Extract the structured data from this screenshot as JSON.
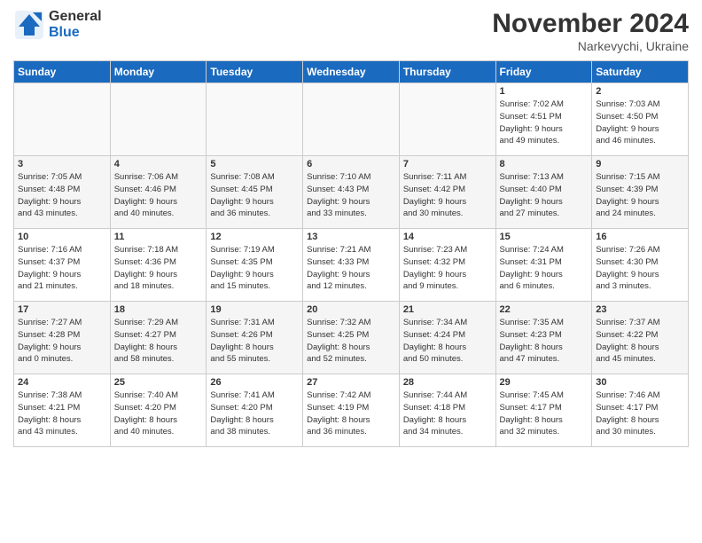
{
  "logo": {
    "general": "General",
    "blue": "Blue"
  },
  "title": "November 2024",
  "location": "Narkevychi, Ukraine",
  "days_of_week": [
    "Sunday",
    "Monday",
    "Tuesday",
    "Wednesday",
    "Thursday",
    "Friday",
    "Saturday"
  ],
  "weeks": [
    [
      {
        "day": "",
        "info": ""
      },
      {
        "day": "",
        "info": ""
      },
      {
        "day": "",
        "info": ""
      },
      {
        "day": "",
        "info": ""
      },
      {
        "day": "",
        "info": ""
      },
      {
        "day": "1",
        "info": "Sunrise: 7:02 AM\nSunset: 4:51 PM\nDaylight: 9 hours\nand 49 minutes."
      },
      {
        "day": "2",
        "info": "Sunrise: 7:03 AM\nSunset: 4:50 PM\nDaylight: 9 hours\nand 46 minutes."
      }
    ],
    [
      {
        "day": "3",
        "info": "Sunrise: 7:05 AM\nSunset: 4:48 PM\nDaylight: 9 hours\nand 43 minutes."
      },
      {
        "day": "4",
        "info": "Sunrise: 7:06 AM\nSunset: 4:46 PM\nDaylight: 9 hours\nand 40 minutes."
      },
      {
        "day": "5",
        "info": "Sunrise: 7:08 AM\nSunset: 4:45 PM\nDaylight: 9 hours\nand 36 minutes."
      },
      {
        "day": "6",
        "info": "Sunrise: 7:10 AM\nSunset: 4:43 PM\nDaylight: 9 hours\nand 33 minutes."
      },
      {
        "day": "7",
        "info": "Sunrise: 7:11 AM\nSunset: 4:42 PM\nDaylight: 9 hours\nand 30 minutes."
      },
      {
        "day": "8",
        "info": "Sunrise: 7:13 AM\nSunset: 4:40 PM\nDaylight: 9 hours\nand 27 minutes."
      },
      {
        "day": "9",
        "info": "Sunrise: 7:15 AM\nSunset: 4:39 PM\nDaylight: 9 hours\nand 24 minutes."
      }
    ],
    [
      {
        "day": "10",
        "info": "Sunrise: 7:16 AM\nSunset: 4:37 PM\nDaylight: 9 hours\nand 21 minutes."
      },
      {
        "day": "11",
        "info": "Sunrise: 7:18 AM\nSunset: 4:36 PM\nDaylight: 9 hours\nand 18 minutes."
      },
      {
        "day": "12",
        "info": "Sunrise: 7:19 AM\nSunset: 4:35 PM\nDaylight: 9 hours\nand 15 minutes."
      },
      {
        "day": "13",
        "info": "Sunrise: 7:21 AM\nSunset: 4:33 PM\nDaylight: 9 hours\nand 12 minutes."
      },
      {
        "day": "14",
        "info": "Sunrise: 7:23 AM\nSunset: 4:32 PM\nDaylight: 9 hours\nand 9 minutes."
      },
      {
        "day": "15",
        "info": "Sunrise: 7:24 AM\nSunset: 4:31 PM\nDaylight: 9 hours\nand 6 minutes."
      },
      {
        "day": "16",
        "info": "Sunrise: 7:26 AM\nSunset: 4:30 PM\nDaylight: 9 hours\nand 3 minutes."
      }
    ],
    [
      {
        "day": "17",
        "info": "Sunrise: 7:27 AM\nSunset: 4:28 PM\nDaylight: 9 hours\nand 0 minutes."
      },
      {
        "day": "18",
        "info": "Sunrise: 7:29 AM\nSunset: 4:27 PM\nDaylight: 8 hours\nand 58 minutes."
      },
      {
        "day": "19",
        "info": "Sunrise: 7:31 AM\nSunset: 4:26 PM\nDaylight: 8 hours\nand 55 minutes."
      },
      {
        "day": "20",
        "info": "Sunrise: 7:32 AM\nSunset: 4:25 PM\nDaylight: 8 hours\nand 52 minutes."
      },
      {
        "day": "21",
        "info": "Sunrise: 7:34 AM\nSunset: 4:24 PM\nDaylight: 8 hours\nand 50 minutes."
      },
      {
        "day": "22",
        "info": "Sunrise: 7:35 AM\nSunset: 4:23 PM\nDaylight: 8 hours\nand 47 minutes."
      },
      {
        "day": "23",
        "info": "Sunrise: 7:37 AM\nSunset: 4:22 PM\nDaylight: 8 hours\nand 45 minutes."
      }
    ],
    [
      {
        "day": "24",
        "info": "Sunrise: 7:38 AM\nSunset: 4:21 PM\nDaylight: 8 hours\nand 43 minutes."
      },
      {
        "day": "25",
        "info": "Sunrise: 7:40 AM\nSunset: 4:20 PM\nDaylight: 8 hours\nand 40 minutes."
      },
      {
        "day": "26",
        "info": "Sunrise: 7:41 AM\nSunset: 4:20 PM\nDaylight: 8 hours\nand 38 minutes."
      },
      {
        "day": "27",
        "info": "Sunrise: 7:42 AM\nSunset: 4:19 PM\nDaylight: 8 hours\nand 36 minutes."
      },
      {
        "day": "28",
        "info": "Sunrise: 7:44 AM\nSunset: 4:18 PM\nDaylight: 8 hours\nand 34 minutes."
      },
      {
        "day": "29",
        "info": "Sunrise: 7:45 AM\nSunset: 4:17 PM\nDaylight: 8 hours\nand 32 minutes."
      },
      {
        "day": "30",
        "info": "Sunrise: 7:46 AM\nSunset: 4:17 PM\nDaylight: 8 hours\nand 30 minutes."
      }
    ]
  ]
}
